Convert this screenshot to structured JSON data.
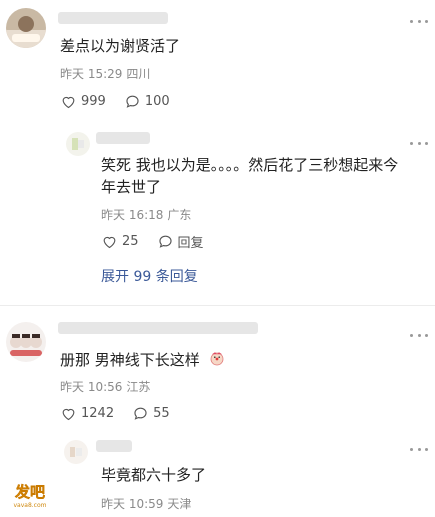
{
  "comments": [
    {
      "text": "差点以为谢贤活了",
      "time": "昨天 15:29",
      "location": "四川",
      "likes": "999",
      "replies_count": "100",
      "reply": {
        "text_line1": "笑死 我也以为是。。。。然后花了三秒想起来今",
        "text_line2": "年去世了",
        "time": "昨天 16:18",
        "location": "广东",
        "likes": "25",
        "reply_label": "回复"
      },
      "expand_label": "展开 99 条回复"
    },
    {
      "text": "册那 男神线下长这样",
      "time": "昨天 10:56",
      "location": "江苏",
      "likes": "1242",
      "replies_count": "55",
      "reply": {
        "text": "毕竟都六十多了",
        "time": "昨天 10:59",
        "location": "天津"
      }
    }
  ],
  "watermark": {
    "brand": "发吧",
    "site": "vava8.com"
  },
  "colors": {
    "link": "#3b5998",
    "meta": "#8a8a8a",
    "text": "#222222"
  }
}
